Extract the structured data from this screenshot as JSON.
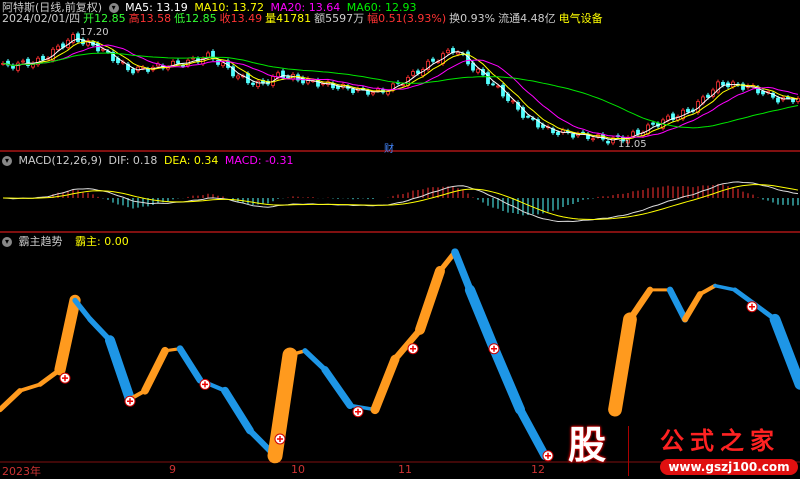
{
  "header": {
    "name": "阿特斯(日线,前复权)",
    "ma5": "MA5: 13.19",
    "ma10": "MA10: 13.72",
    "ma20": "MA20: 13.64",
    "ma60": "MA60: 12.93"
  },
  "quote": {
    "date": "2024/02/01/四",
    "open": "开12.85",
    "high": "高13.58",
    "low": "低12.85",
    "close": "收13.49",
    "volume": "量41781",
    "amount": "额5597万",
    "change": "幅0.51(3.93%)",
    "turnover": "换0.93%",
    "float": "流通4.48亿",
    "sector": "电气设备"
  },
  "main_chart": {
    "high_label": "17.20",
    "low_label": "11.05",
    "marker": "财",
    "closes": [
      [
        0,
        15.2
      ],
      [
        40,
        15.5
      ],
      [
        72,
        16.8
      ],
      [
        100,
        16.2
      ],
      [
        130,
        15.0
      ],
      [
        160,
        15.2
      ],
      [
        190,
        15.5
      ],
      [
        210,
        15.8
      ],
      [
        240,
        14.6
      ],
      [
        260,
        14.2
      ],
      [
        280,
        14.8
      ],
      [
        300,
        14.5
      ],
      [
        330,
        14.2
      ],
      [
        360,
        13.9
      ],
      [
        380,
        13.8
      ],
      [
        400,
        14.3
      ],
      [
        430,
        15.4
      ],
      [
        455,
        16.2
      ],
      [
        470,
        15.3
      ],
      [
        500,
        13.9
      ],
      [
        525,
        12.5
      ],
      [
        550,
        11.7
      ],
      [
        580,
        11.5
      ],
      [
        610,
        11.2
      ],
      [
        630,
        11.4
      ],
      [
        660,
        12.2
      ],
      [
        690,
        12.8
      ],
      [
        720,
        14.3
      ],
      [
        750,
        14.1
      ],
      [
        780,
        13.4
      ],
      [
        800,
        13.5
      ]
    ],
    "ylim": [
      11.05,
      17.2
    ]
  },
  "macd": {
    "label": "MACD(12,26,9)",
    "dif": "DIF: 0.18",
    "dea": "DEA: 0.34",
    "macd": "MACD: -0.31"
  },
  "indicator": {
    "label": "霸主趋势",
    "value": "霸主: 0.00",
    "points": [
      [
        0,
        24
      ],
      [
        20,
        33
      ],
      [
        40,
        36
      ],
      [
        60,
        43
      ],
      [
        75,
        76
      ],
      [
        90,
        67
      ],
      [
        110,
        57
      ],
      [
        130,
        29
      ],
      [
        145,
        33
      ],
      [
        165,
        52
      ],
      [
        180,
        53
      ],
      [
        200,
        38
      ],
      [
        225,
        33
      ],
      [
        250,
        14
      ],
      [
        275,
        2
      ],
      [
        290,
        50
      ],
      [
        305,
        52
      ],
      [
        325,
        43
      ],
      [
        350,
        26
      ],
      [
        375,
        24
      ],
      [
        395,
        48
      ],
      [
        420,
        62
      ],
      [
        440,
        90
      ],
      [
        455,
        99
      ],
      [
        470,
        81
      ],
      [
        495,
        52
      ],
      [
        520,
        24
      ],
      [
        545,
        2
      ],
      null,
      [
        615,
        24
      ],
      [
        630,
        67
      ],
      [
        650,
        81
      ],
      [
        670,
        81
      ],
      [
        685,
        67
      ],
      [
        700,
        79
      ],
      [
        715,
        83
      ],
      [
        735,
        81
      ],
      [
        755,
        74
      ],
      [
        775,
        67
      ],
      [
        800,
        36
      ]
    ],
    "signals": [
      [
        65,
        39
      ],
      [
        130,
        28
      ],
      [
        205,
        36
      ],
      [
        280,
        10
      ],
      [
        358,
        23
      ],
      [
        413,
        53
      ],
      [
        494,
        53
      ],
      [
        548,
        2
      ],
      [
        752,
        73
      ]
    ]
  },
  "xaxis": [
    "2023年",
    "9",
    "10",
    "11",
    "12"
  ],
  "watermark": {
    "char": "股",
    "title": "公式之家",
    "url": "www.gszj100.com"
  },
  "colors": {
    "up": "#ff3232",
    "down": "#54ffff",
    "ma5": "#ffffff",
    "ma10": "#ffff00",
    "ma20": "#ff00ff",
    "ma60": "#00e600",
    "orange": "#ff9a1e",
    "blue": "#1e96e6"
  }
}
